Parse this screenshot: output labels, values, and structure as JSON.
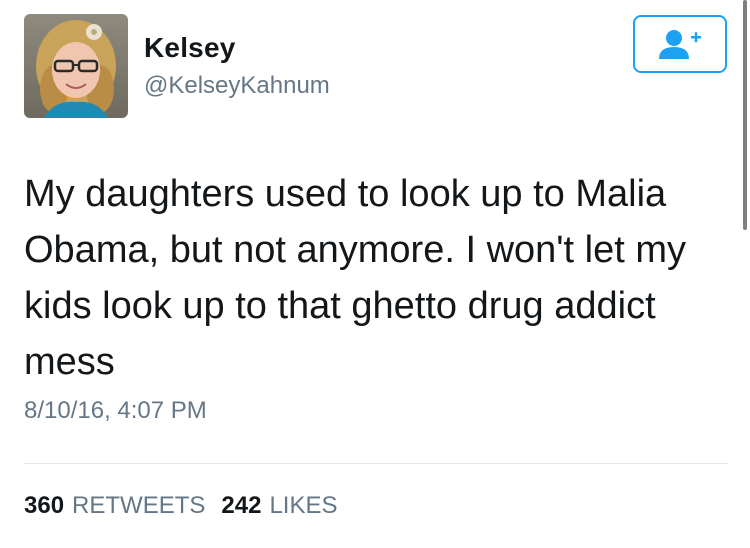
{
  "user": {
    "name": "Kelsey",
    "handle": "@KelseyKahnum"
  },
  "follow_button": {
    "icon": "follow-user-icon"
  },
  "tweet": {
    "text": "My daughters used to look up to Malia\nObama, but not anymore. I won't let my\nkids look up to that ghetto drug addict\nmess",
    "timestamp": "8/10/16, 4:07 PM"
  },
  "stats": {
    "retweets_count": "360",
    "retweets_label": "RETWEETS",
    "likes_count": "242",
    "likes_label": "LIKES"
  },
  "colors": {
    "accent": "#1da1f2",
    "text": "#14171a",
    "secondary": "#657786",
    "divider": "#e1e8ed"
  }
}
